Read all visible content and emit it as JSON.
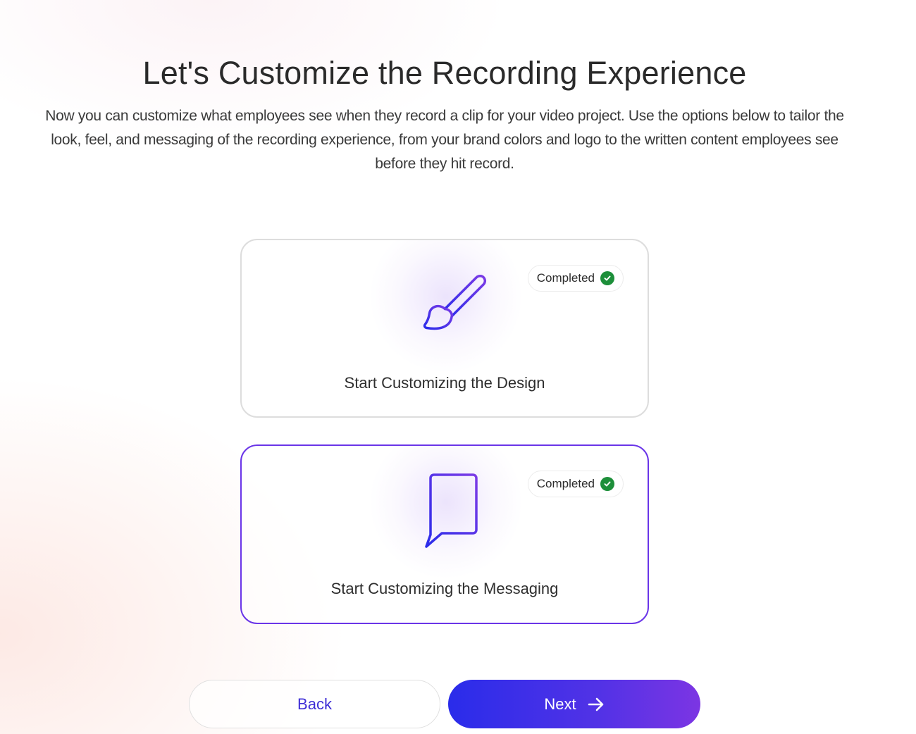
{
  "header": {
    "title": "Let's Customize the Recording Experience",
    "subtitle": "Now you can customize what employees see when they record a clip for your video project. Use the options below to tailor the look, feel, and messaging of the recording experience, from your brand colors and logo to the written content employees see before they hit record."
  },
  "cards": [
    {
      "id": "design",
      "label": "Start Customizing the Design",
      "status": "Completed",
      "icon": "paintbrush-icon",
      "selected": false
    },
    {
      "id": "messaging",
      "label": "Start Customizing the Messaging",
      "status": "Completed",
      "icon": "message-icon",
      "selected": true
    }
  ],
  "footer": {
    "back_label": "Back",
    "next_label": "Next",
    "next_icon": "arrow-right-icon"
  },
  "colors": {
    "accent_start": "#2a2cea",
    "accent_end": "#7c35e3",
    "selected_border": "#6a35e8",
    "completed_green": "#1d8f3a"
  }
}
